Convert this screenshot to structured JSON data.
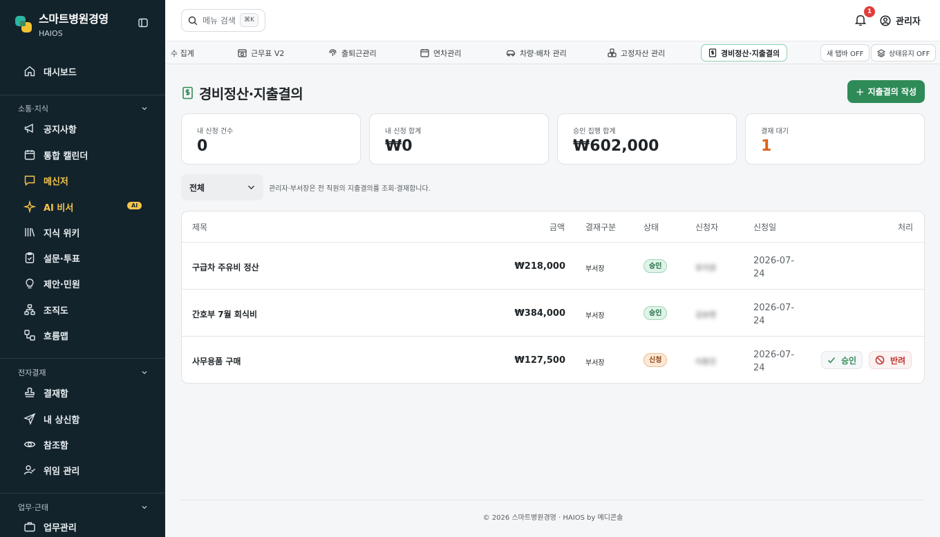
{
  "app": {
    "name": "스마트병원경영",
    "sub": "HAIOS"
  },
  "sidebar": {
    "dashboard": "대시보드",
    "section1": {
      "title": "소통·지식",
      "items": [
        {
          "label": "공지사항",
          "icon": "megaphone-icon"
        },
        {
          "label": "통합 캘린더",
          "icon": "calendar-icon"
        },
        {
          "label": "메신저",
          "icon": "message-icon"
        },
        {
          "label": "AI 비서",
          "icon": "sparkle-icon",
          "badge": "AI"
        },
        {
          "label": "지식 위키",
          "icon": "library-icon"
        },
        {
          "label": "설문·투표",
          "icon": "clipboard-icon"
        },
        {
          "label": "제안·민원",
          "icon": "lightbulb-icon"
        },
        {
          "label": "조직도",
          "icon": "org-chart-icon"
        },
        {
          "label": "흐름맵",
          "icon": "flow-icon"
        }
      ]
    },
    "section2": {
      "title": "전자결재",
      "items": [
        {
          "label": "결재함",
          "icon": "stamp-icon"
        },
        {
          "label": "내 상신함",
          "icon": "send-icon"
        },
        {
          "label": "참조함",
          "icon": "eye-icon"
        },
        {
          "label": "위임 관리",
          "icon": "user-check-icon"
        }
      ]
    },
    "section3": {
      "title": "업무·근태",
      "items": [
        {
          "label": "업무관리",
          "icon": "briefcase-icon"
        }
      ]
    }
  },
  "topbar": {
    "search_label": "메뉴 검색",
    "shortcut": "⌘K",
    "notification_count": "1",
    "user": "관리자"
  },
  "tabs": [
    {
      "label": "수 집계"
    },
    {
      "label": "근무표 V2"
    },
    {
      "label": "출퇴근관리"
    },
    {
      "label": "연차관리"
    },
    {
      "label": "차량·배차 관리"
    },
    {
      "label": "고정자산 관리"
    },
    {
      "label": "경비정산·지출결의"
    }
  ],
  "tab_toggles": {
    "new_tab": "새 탭바 OFF",
    "keep_state": "상태유지 OFF"
  },
  "page": {
    "title": "경비정산·지출결의",
    "create_button": "지출결의 작성",
    "stats": [
      {
        "label": "내 신청 건수",
        "value": "0"
      },
      {
        "label": "내 신청 합계",
        "value": "₩0"
      },
      {
        "label": "승인 집행 합계",
        "value": "₩602,000"
      },
      {
        "label": "결재 대기",
        "value": "1"
      }
    ],
    "filter": {
      "selected": "전체",
      "hint": "관리자·부서장은 전 직원의 지출결의를 조회·결재합니다."
    },
    "table": {
      "headers": [
        "제목",
        "금액",
        "결재구분",
        "상태",
        "신청자",
        "신청일",
        "처리"
      ],
      "rows": [
        {
          "title": "구급차 주유비 정산",
          "amount": "₩218,000",
          "type": "부서장",
          "status": "승인",
          "applicant": "유지원",
          "date": "2026-07-24"
        },
        {
          "title": "간호부 7월 회식비",
          "amount": "₩384,000",
          "type": "부서장",
          "status": "승인",
          "applicant": "김보현",
          "date": "2026-07-24"
        },
        {
          "title": "사무용품 구매",
          "amount": "₩127,500",
          "type": "부서장",
          "status": "신청",
          "applicant": "이환진",
          "date": "2026-07-24"
        }
      ],
      "actions": {
        "approve": "승인",
        "reject": "반려"
      }
    }
  },
  "footer": "© 2026 스마트병원경영 · HAIOS by 메디콘솔",
  "colors": {
    "sidebar_bg": "#13232c",
    "accent": "#2e8b57",
    "active_nav": "#f5c54a",
    "pending": "#e0601c"
  }
}
